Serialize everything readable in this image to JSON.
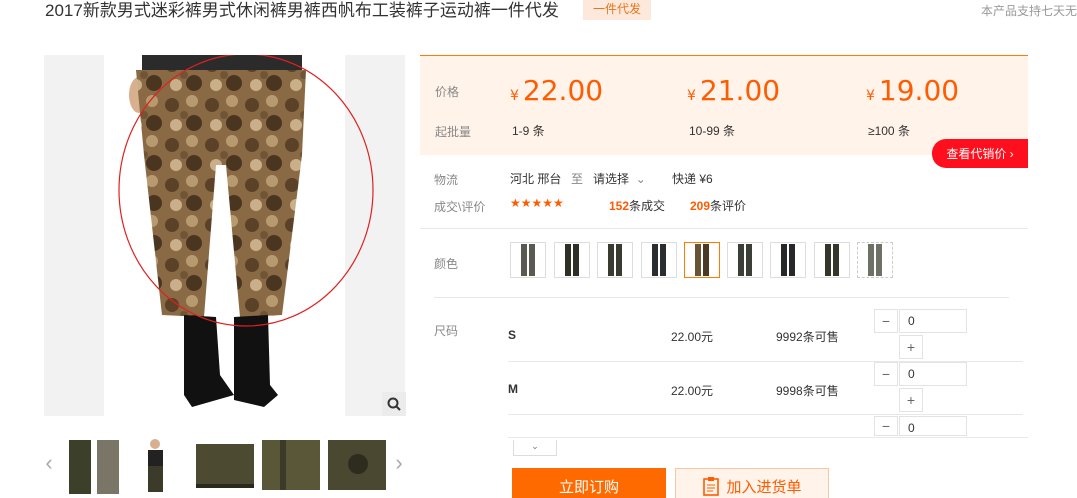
{
  "product": {
    "title": "2017新款男式迷彩裤男式休闲裤男裤西帆布工装裤子运动裤一件代发",
    "badge": "一件代发",
    "top_note": "本产品支持七天无"
  },
  "price": {
    "price_label": "价格",
    "moq_label": "起批量",
    "currency": "¥",
    "tiers": [
      {
        "price": "22.00",
        "range": "1-9 条"
      },
      {
        "price": "21.00",
        "range": "10-99 条"
      },
      {
        "price": "19.00",
        "range": "≥100 条"
      }
    ],
    "agent_button": "查看代销价"
  },
  "logistics": {
    "label": "物流",
    "from": "河北 邢台",
    "to_word": "至",
    "select": "请选择",
    "express": "快递 ¥6"
  },
  "reviews": {
    "label": "成交\\评价",
    "stars": "★★★★★",
    "deals_num": "152",
    "deals_text": "条成交",
    "reviews_num": "209",
    "reviews_text": "条评价"
  },
  "color": {
    "label": "颜色"
  },
  "sizes": {
    "label": "尺码",
    "rows": [
      {
        "name": "S",
        "price": "22.00元",
        "stock": "9992条可售",
        "qty": "0"
      },
      {
        "name": "M",
        "price": "22.00元",
        "stock": "9998条可售",
        "qty": "0"
      },
      {
        "name": "",
        "price": "",
        "stock": "",
        "qty": "0"
      }
    ],
    "minus": "−",
    "plus": "+"
  },
  "actions": {
    "buy": "立即订购",
    "cart": "加入进货单"
  },
  "colors": {
    "accent": "#ff6a00",
    "price": "#ff5b00",
    "agent_red": "#ff0f1d"
  }
}
